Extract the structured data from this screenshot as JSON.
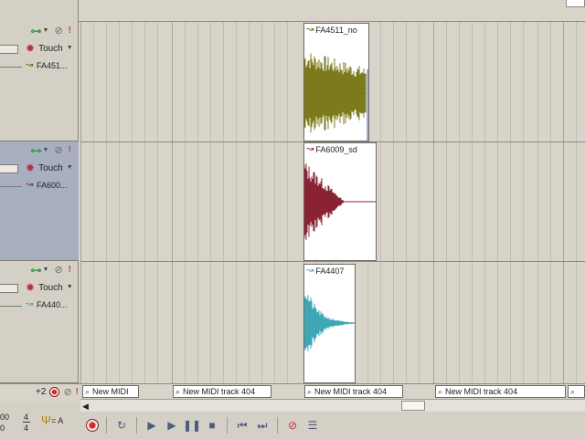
{
  "tracks": [
    {
      "automation_mode": "Touch",
      "lane_label": "FA451...",
      "clip_title": "FA4511_no",
      "clip_color": "#7d7a1c",
      "selected": false
    },
    {
      "automation_mode": "Touch",
      "lane_label": "FA600...",
      "clip_title": "FA6009_sd",
      "clip_color": "#8b2234",
      "selected": true
    },
    {
      "automation_mode": "Touch",
      "lane_label": "FA440...",
      "clip_title": "FA4407",
      "clip_color": "#3fa6b4",
      "selected": false
    }
  ],
  "midi_track": {
    "transpose": "+2",
    "clips": [
      "New MIDI",
      "New MIDI track 404",
      "New MIDI track 404",
      "New MIDI track 404"
    ]
  },
  "tempo": {
    "value_fragment": "00",
    "value_fragment2": "0",
    "meter_top": "4",
    "meter_bottom": "4",
    "key": "= A"
  },
  "colors": {
    "selected_track": "#a7afc0",
    "grid_major": "#a6a39a",
    "transport_icon": "#4c5d80"
  }
}
